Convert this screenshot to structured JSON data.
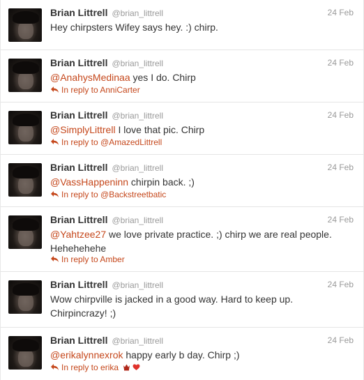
{
  "author": {
    "name": "Brian Littrell",
    "handle": "@brian_littrell"
  },
  "colors": {
    "link": "#c5471b",
    "meta": "#999999",
    "text": "#333333"
  },
  "tweets": [
    {
      "time": "24 Feb",
      "mention": "",
      "text": "Hey chirpsters Wifey says hey. :) chirp.",
      "reply_to": ""
    },
    {
      "time": "24 Feb",
      "mention": "@AnahysMedinaa",
      "text": " yes I do. Chirp",
      "reply_to": "In reply to AnniCarter"
    },
    {
      "time": "24 Feb",
      "mention": "@SimplyLittrell",
      "text": " I love that pic. Chirp",
      "reply_to": "In reply to @AmazedLittrell"
    },
    {
      "time": "24 Feb",
      "mention": "@VassHappeninn",
      "text": " chirpin back. ;)",
      "reply_to": "In reply to @Backstreetbatic"
    },
    {
      "time": "24 Feb",
      "mention": "@Yahtzee27",
      "text": " we love private practice. ;) chirp we are real people. Hehehehehe",
      "reply_to": "In reply to Amber"
    },
    {
      "time": "24 Feb",
      "mention": "",
      "text": "Wow chirpville is jacked in a good way. Hard to keep up. Chirpincrazy! ;)",
      "reply_to": ""
    },
    {
      "time": "24 Feb",
      "mention": "@erikalynnexrok",
      "text": " happy early b day. Chirp ;)",
      "reply_to": "In reply to erika",
      "reply_icons": [
        "crown-icon",
        "heart-icon"
      ]
    }
  ]
}
